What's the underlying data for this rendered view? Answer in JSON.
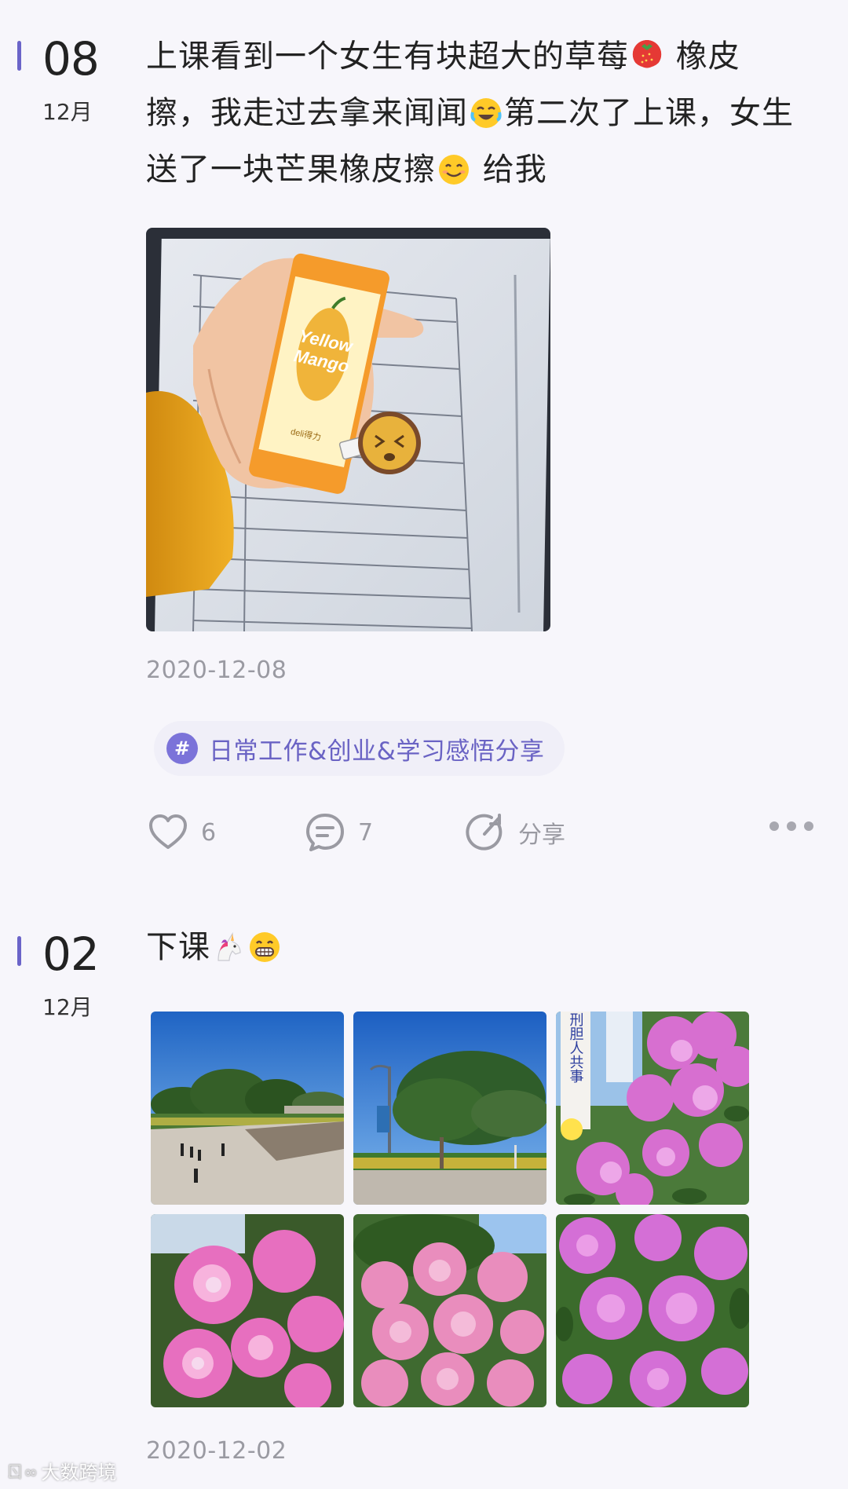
{
  "posts": [
    {
      "day": "08",
      "month": "12月",
      "text_part1": "上课看到一个女生有块超大的草莓",
      "text_part2": " 橡皮擦，我走过去拿来闻闻",
      "text_part3": "第二次了上课，女生送了一块芒果橡皮擦",
      "text_part4": " 给我",
      "image_text": {
        "brand_line1": "Yellow",
        "brand_line2": "Mango",
        "maker": "deli得力"
      },
      "date": "2020-12-08",
      "topic": {
        "symbol": "#",
        "label": "日常工作&创业&学习感悟分享"
      },
      "likes": "6",
      "comments": "7",
      "share_label": "分享"
    },
    {
      "day": "02",
      "month": "12月",
      "text": "下课",
      "date": "2020-12-02",
      "photo_sign_text": "刑胆人共事"
    }
  ],
  "watermark": {
    "logo": "ㄖ∞",
    "text": "大数跨境"
  },
  "colors": {
    "accent": "#6b64c9",
    "tag_bg": "#f0eff8",
    "muted": "#9a9aa2"
  }
}
